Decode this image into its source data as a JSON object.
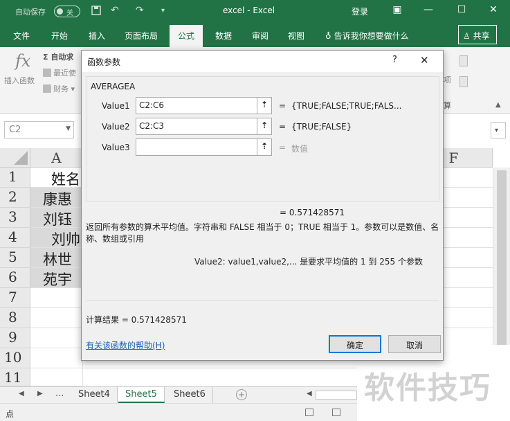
{
  "colors": {
    "brand": "#217346",
    "link": "#1a5fb4",
    "focus": "#0078d7"
  },
  "titlebar": {
    "autosave_label": "自动保存",
    "autosave_state": "关",
    "save_icon": "save-icon",
    "undo_icon": "undo-icon",
    "redo_icon": "redo-icon",
    "title": "excel  -  Excel",
    "login": "登录"
  },
  "tabs": {
    "items": [
      "文件",
      "开始",
      "插入",
      "页面布局",
      "公式",
      "数据",
      "审阅",
      "视图"
    ],
    "active": "公式",
    "tell_me": "告诉我你想要做什么",
    "share": "共享"
  },
  "ribbon": {
    "insert_function_icon": "fx",
    "insert_function": "插入函数",
    "autosum": "自动求",
    "recent": "最近使",
    "finance": "财务",
    "right_label_1": "项",
    "right_label_2": "算"
  },
  "formula_bar": {
    "namebox": "C2"
  },
  "grid": {
    "columns": [
      "A",
      "F"
    ],
    "rows": [
      "1",
      "2",
      "3",
      "4",
      "5",
      "6",
      "7",
      "8",
      "9",
      "10",
      "11"
    ],
    "col_a": [
      "姓名",
      "康惠",
      "刘钰",
      "刘帅",
      "林世",
      "苑宇"
    ]
  },
  "sheets": {
    "ellipsis": "...",
    "tabs": [
      "Sheet4",
      "Sheet5",
      "Sheet6"
    ],
    "active": "Sheet5"
  },
  "status": {
    "mode": "点"
  },
  "dialog": {
    "title": "函数参数",
    "help_glyph": "?",
    "close_glyph": "✕",
    "function_name": "AVERAGEA",
    "args": [
      {
        "label": "Value1",
        "value": "C2:C6",
        "eq": "=",
        "result": "{TRUE;FALSE;TRUE;FALS..."
      },
      {
        "label": "Value2",
        "value": "C2:C3",
        "eq": "=",
        "result": "{TRUE;FALSE}"
      },
      {
        "label": "Value3",
        "value": "",
        "eq": "=",
        "result": "数值"
      }
    ],
    "result_line": "=   0.571428571",
    "description": "返回所有参数的算术平均值。字符串和 FALSE 相当于 0；TRUE 相当于 1。参数可以是数值、名称、数组或引用",
    "arg_description": "Value2:  value1,value2,... 是要求平均值的 1 到 255 个参数",
    "calc_result": "计算结果 =   0.571428571",
    "help_link": "有关该函数的帮助(H)",
    "ok": "确定",
    "cancel": "取消"
  },
  "watermark": {
    "text": "软件技巧"
  }
}
